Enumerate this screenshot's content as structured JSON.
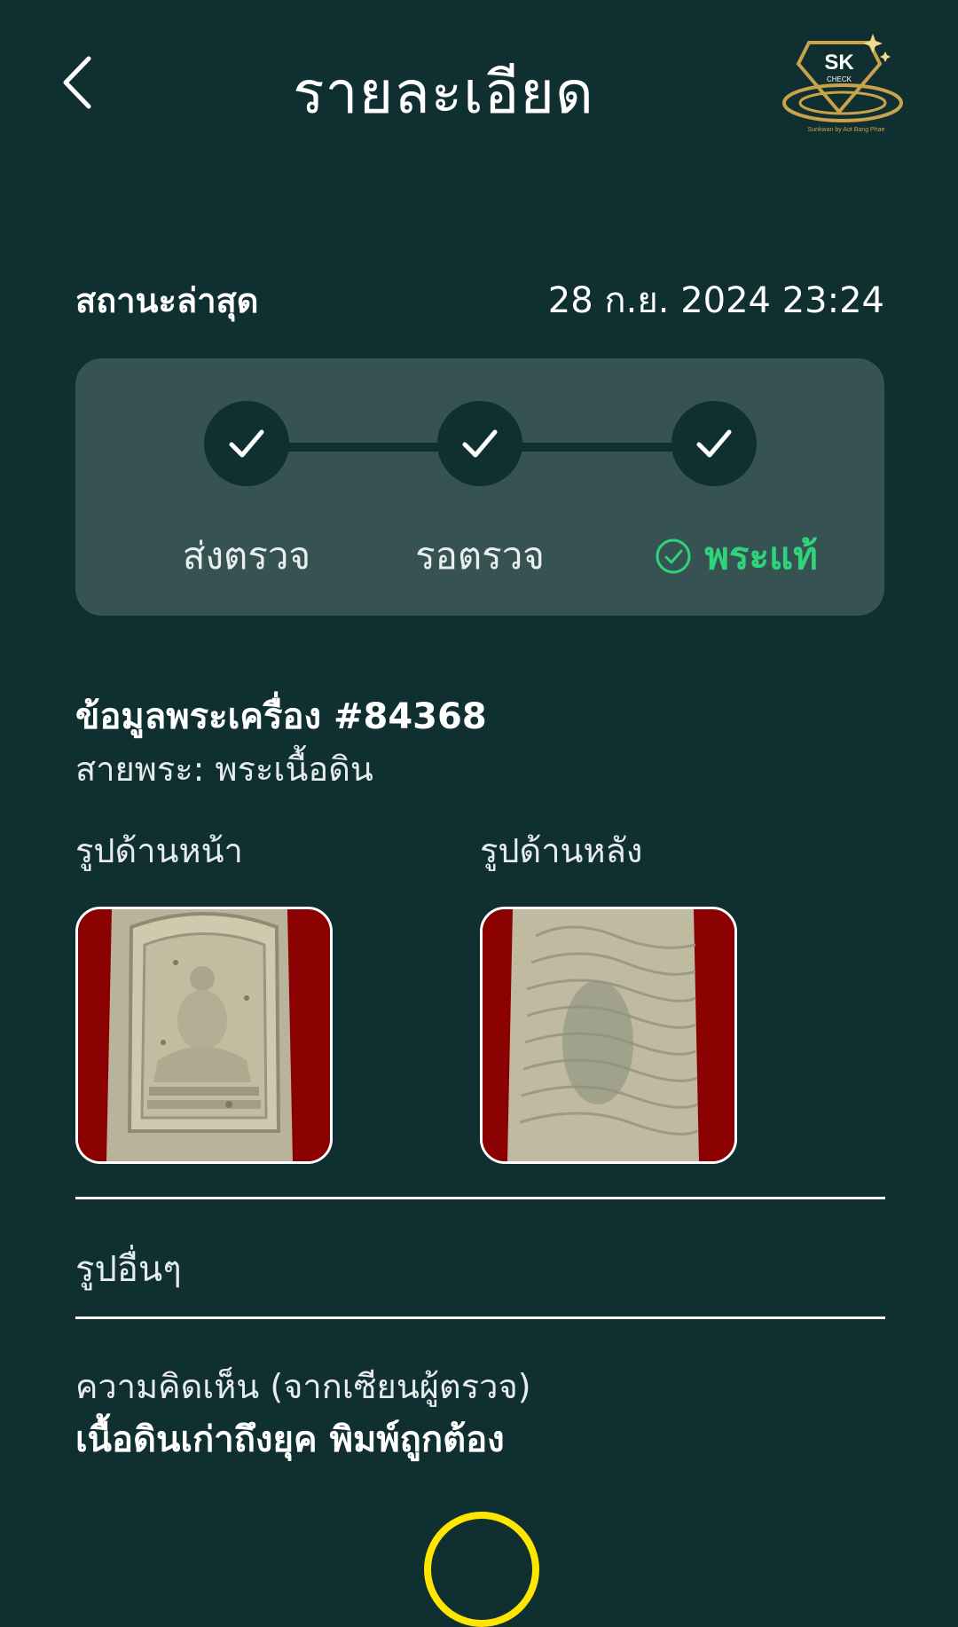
{
  "header": {
    "title": "รายละเอียด",
    "logo_text": "SK",
    "logo_subtext": "CHECK",
    "logo_tagline": "Sunkwan by Aot Bang Phae"
  },
  "status": {
    "label": "สถานะล่าสุด",
    "datetime": "28 ก.ย. 2024 23:24"
  },
  "steps": [
    {
      "label": "ส่งตรวจ",
      "completed": true
    },
    {
      "label": "รอตรวจ",
      "completed": true
    },
    {
      "label": "พระแท้",
      "completed": true,
      "result_color": "#2fd37a"
    }
  ],
  "amulet": {
    "title": "ข้อมูลพระเครื่อง #84368",
    "category": "สายพระ: พระเนื้อดิน",
    "front_label": "รูปด้านหน้า",
    "back_label": "รูปด้านหลัง"
  },
  "other_images_label": "รูปอื่นๆ",
  "comment": {
    "label": "ความคิดเห็น (จากเซียนผู้ตรวจ)",
    "text": "เนื้อดินเก่าถึงยุค พิมพ์ถูกต้อง"
  },
  "colors": {
    "background": "#0f2f31",
    "card": "#375253",
    "success": "#2fd37a",
    "accent_gold": "#c9a24a"
  }
}
